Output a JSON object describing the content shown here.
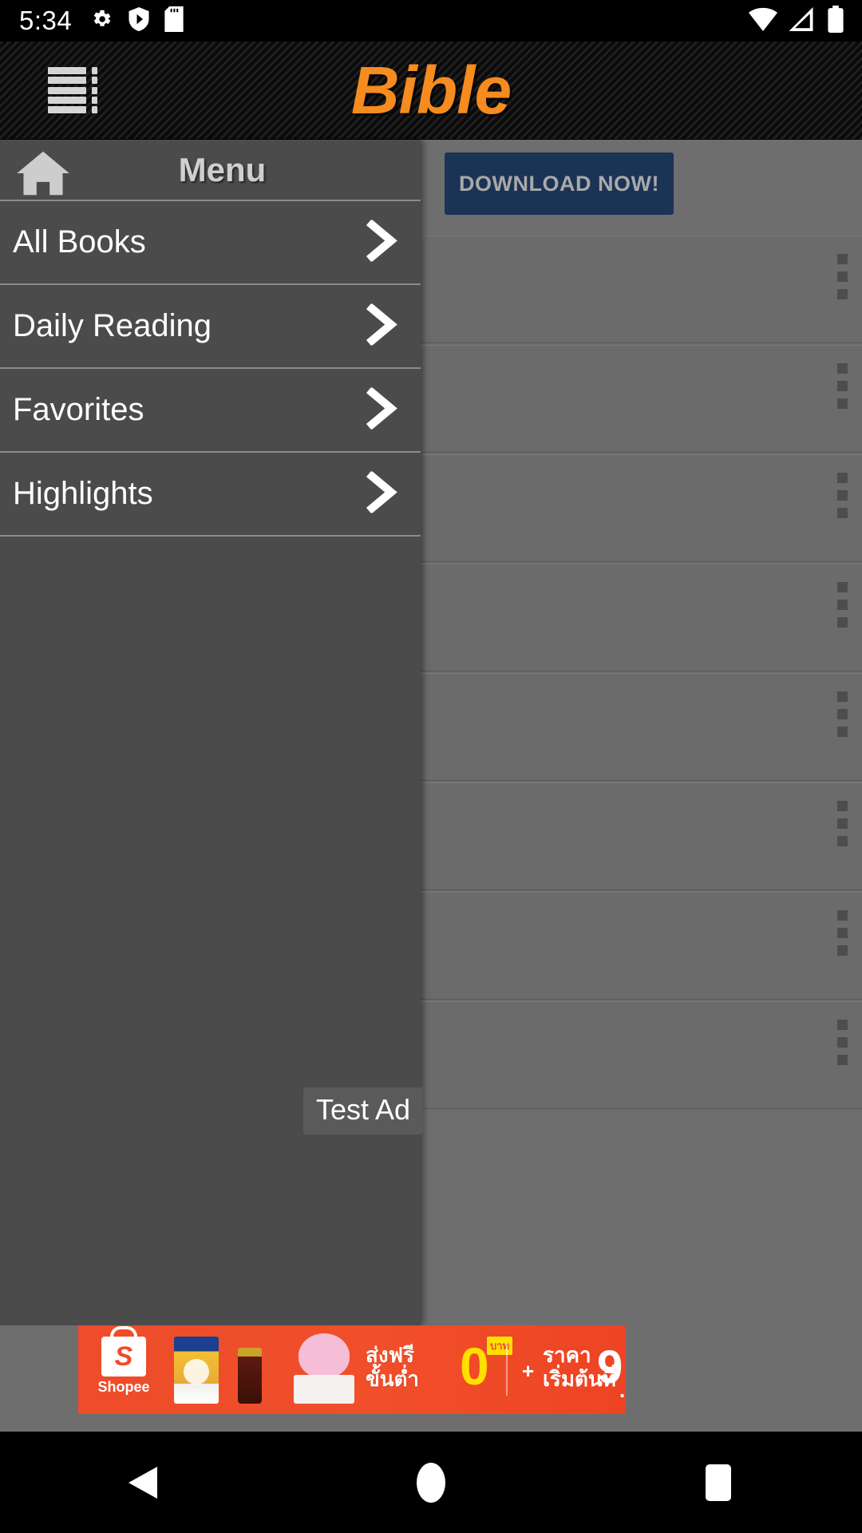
{
  "status_bar": {
    "time": "5:34",
    "left_icons": [
      "gear-icon",
      "shield-play-icon",
      "sd-card-icon"
    ],
    "right_icons": [
      "wifi-icon",
      "cellular-signal-icon",
      "battery-icon"
    ]
  },
  "app_bar": {
    "title": "Bible",
    "title_color": "#F68B1F",
    "menu_icon": "hamburger-menu-icon"
  },
  "drawer": {
    "header": {
      "home_icon": "home-icon",
      "title": "Menu"
    },
    "items": [
      {
        "label": "All Books",
        "chevron": "chevron-right-icon"
      },
      {
        "label": "Daily Reading",
        "chevron": "chevron-right-icon"
      },
      {
        "label": "Favorites",
        "chevron": "chevron-right-icon"
      },
      {
        "label": "Highlights",
        "chevron": "chevron-right-icon"
      }
    ]
  },
  "content": {
    "snippet_text": ".",
    "download_button": {
      "label": "DOWNLOAD NOW!",
      "background": "#1b3355",
      "text_color": "#a9a9a9"
    },
    "cards": [
      {
        "overflow_icon": "kebab-menu-icon"
      },
      {
        "overflow_icon": "kebab-menu-icon"
      },
      {
        "overflow_icon": "kebab-menu-icon"
      },
      {
        "overflow_icon": "kebab-menu-icon"
      },
      {
        "overflow_icon": "kebab-menu-icon"
      },
      {
        "overflow_icon": "kebab-menu-icon"
      },
      {
        "overflow_icon": "kebab-menu-icon"
      },
      {
        "overflow_icon": "kebab-menu-icon"
      }
    ]
  },
  "ad": {
    "label": "Test Ad",
    "brand": "Shopee",
    "brand_mark": "S",
    "background": "#ee4c2b",
    "line1": "ส่งฟรี",
    "line2": "ขั้นต่ำ",
    "amount": "0",
    "amount_unit": "บาท",
    "plus": "+",
    "line3": "ราคา",
    "line4": "เริ่มต้นที่",
    "price": "9",
    "price_suffix": ".-"
  },
  "nav_bar": {
    "back": "back-triangle-icon",
    "home": "home-circle-icon",
    "recents": "recents-square-icon"
  }
}
